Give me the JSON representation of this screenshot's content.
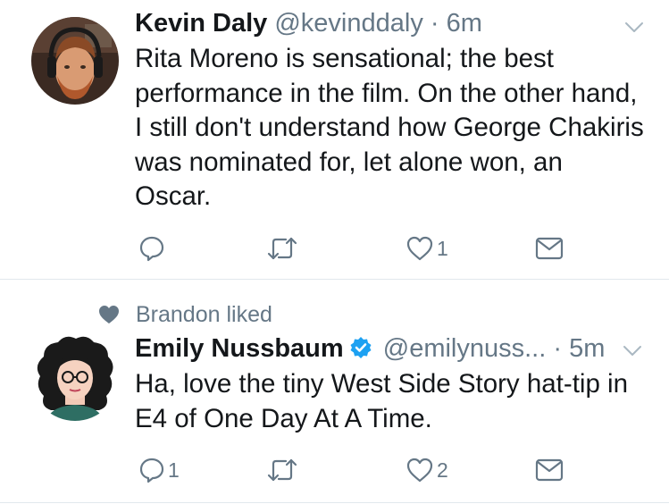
{
  "tweets": [
    {
      "author": {
        "name": "Kevin Daly",
        "handle": "@kevinddaly"
      },
      "separator": "·",
      "time": "6m",
      "text": "Rita Moreno is sensational; the best performance in the film. On the other hand, I still don't understand how George Chakiris was nominated for, let alone won, an Oscar.",
      "reply_count": "",
      "like_count": "1"
    },
    {
      "social_context": "Brandon liked",
      "author": {
        "name": "Emily Nussbaum",
        "handle": "@emilynuss...",
        "verified": true
      },
      "separator": "·",
      "time": "5m",
      "text": "Ha, love the tiny West Side Story hat-tip in E4 of One Day At A Time.",
      "reply_count": "1",
      "like_count": "2"
    }
  ],
  "colors": {
    "text": "#14171a",
    "secondary": "#657786",
    "verified": "#1da1f2",
    "divider": "#e1e8ed"
  },
  "icons": [
    "reply-icon",
    "retweet-icon",
    "like-icon",
    "direct-message-icon",
    "caret-down-icon",
    "verified-icon",
    "heart-filled-icon"
  ]
}
